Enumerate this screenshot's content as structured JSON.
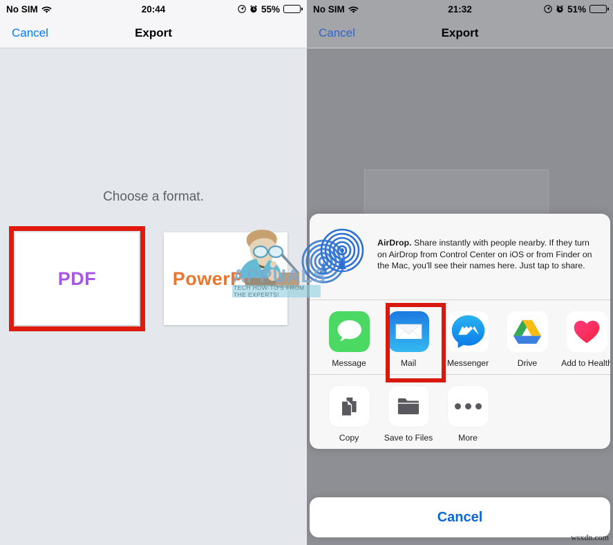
{
  "left_screen": {
    "status_bar": {
      "carrier": "No SIM",
      "wifi_icon": "wifi-icon",
      "time": "20:44",
      "location_icon": "location-arrow-icon",
      "alarm_icon": "alarm-clock-icon",
      "battery_percent": "55%",
      "battery_level": 55
    },
    "nav_bar": {
      "cancel_label": "Cancel",
      "title": "Export"
    },
    "prompt": "Choose a format.",
    "formats": [
      {
        "label": "PDF",
        "color": "#a855e8",
        "selected": true
      },
      {
        "label": "PowerPoint",
        "color": "#e8762c",
        "selected": false
      }
    ],
    "selection_highlight_color": "#e01b0e"
  },
  "right_screen": {
    "status_bar": {
      "carrier": "No SIM",
      "wifi_icon": "wifi-icon",
      "time": "21:32",
      "location_icon": "location-arrow-icon",
      "alarm_icon": "alarm-clock-icon",
      "battery_percent": "51%",
      "battery_level": 51
    },
    "nav_bar": {
      "cancel_label": "Cancel",
      "title": "Export"
    },
    "share_sheet": {
      "airdrop": {
        "icon": "airdrop-icon",
        "title": "AirDrop.",
        "description": " Share instantly with people nearby. If they turn on AirDrop from Control Center on iOS or from Finder on the Mac, you'll see their names here. Just tap to share."
      },
      "apps": [
        {
          "label": "Message",
          "icon": "messages-icon",
          "selected": false
        },
        {
          "label": "Mail",
          "icon": "mail-icon",
          "selected": true
        },
        {
          "label": "Messenger",
          "icon": "messenger-icon",
          "selected": false
        },
        {
          "label": "Drive",
          "icon": "google-drive-icon",
          "selected": false
        },
        {
          "label": "Add to Health",
          "icon": "health-heart-icon",
          "selected": false
        }
      ],
      "actions": [
        {
          "label": "Copy",
          "icon": "copy-documents-icon"
        },
        {
          "label": "Save to Files",
          "icon": "folder-icon"
        },
        {
          "label": "More",
          "icon": "more-dots-icon"
        }
      ],
      "selection_highlight_color": "#d71a0d"
    },
    "cancel_button": "Cancel"
  },
  "watermarks": {
    "brand": "APPUALS",
    "tagline_line1": "TECH HOW-TO'S FROM",
    "tagline_line2": "THE EXPERTS!",
    "corner": "wsxdn.com"
  }
}
